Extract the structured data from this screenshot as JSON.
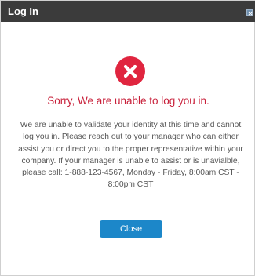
{
  "dialog": {
    "title": "Log In",
    "close_icon": "close-icon",
    "status_icon": "error-x-icon",
    "heading": "Sorry, We are unable to log you in.",
    "message": "We are unable to validate your identity at this time and cannot log you in. Please reach out to your manager who can either assist you or direct you to the proper representative within your company. If your manager is unable to assist or is unavialble, please call: 1-888-123-4567, Monday - Friday, 8:00am CST - 8:00pm CST",
    "close_button_label": "Close"
  },
  "colors": {
    "titlebar": "#3b3b3b",
    "error_red": "#e0253f",
    "heading_red": "#c8203a",
    "button_blue": "#1c87c9",
    "body_text": "#555555"
  }
}
